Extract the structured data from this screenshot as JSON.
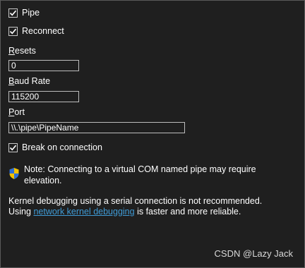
{
  "pipe": {
    "label": "Pipe",
    "checked": true
  },
  "reconnect": {
    "label": "Reconnect",
    "checked": true
  },
  "resets": {
    "label_accel": "R",
    "label_rest": "esets",
    "value": "0"
  },
  "baud_rate": {
    "label_accel": "B",
    "label_rest": "aud Rate",
    "value": "115200"
  },
  "port": {
    "label_accel": "P",
    "label_rest": "ort",
    "value": "\\\\.\\pipe\\PipeName"
  },
  "break_on_connection": {
    "label": "Break on connection",
    "checked": true
  },
  "note": {
    "icon": "uac-shield-icon",
    "text": "Note: Connecting to a virtual COM named pipe may require elevation."
  },
  "info": {
    "line1": "Kernel debugging using a serial connection is not recommended.",
    "prefix": "Using ",
    "link_text": "network kernel debugging",
    "suffix": " is faster and more reliable."
  },
  "watermark": "CSDN @Lazy Jack",
  "colors": {
    "background": "#1f1f1f",
    "link": "#3f9bd6",
    "border": "#bdbdbd"
  }
}
